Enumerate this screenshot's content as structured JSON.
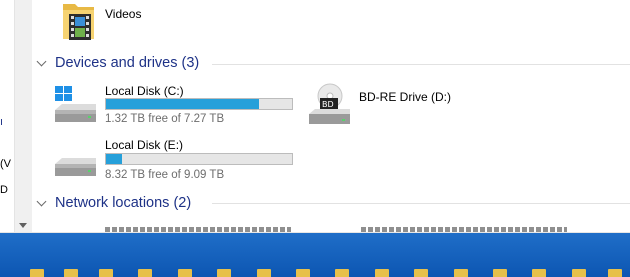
{
  "nav_fragments": [
    "(V",
    "D"
  ],
  "folders": [
    {
      "label": "Videos"
    }
  ],
  "groups": {
    "devices": {
      "label": "Devices and drives (3)"
    },
    "network": {
      "label": "Network locations (2)"
    }
  },
  "drives": [
    {
      "name": "Local Disk (C:)",
      "free_text": "1.32 TB free of 7.27 TB",
      "used_fraction": 0.82
    },
    {
      "name": "BD-RE Drive (D:)"
    },
    {
      "name": "Local Disk (E:)",
      "free_text": "8.32 TB free of 9.09 TB",
      "used_fraction": 0.085
    }
  ],
  "colors": {
    "header": "#1e3287",
    "bar_fill": "#26a0da",
    "taskbar": "#1266c0"
  }
}
